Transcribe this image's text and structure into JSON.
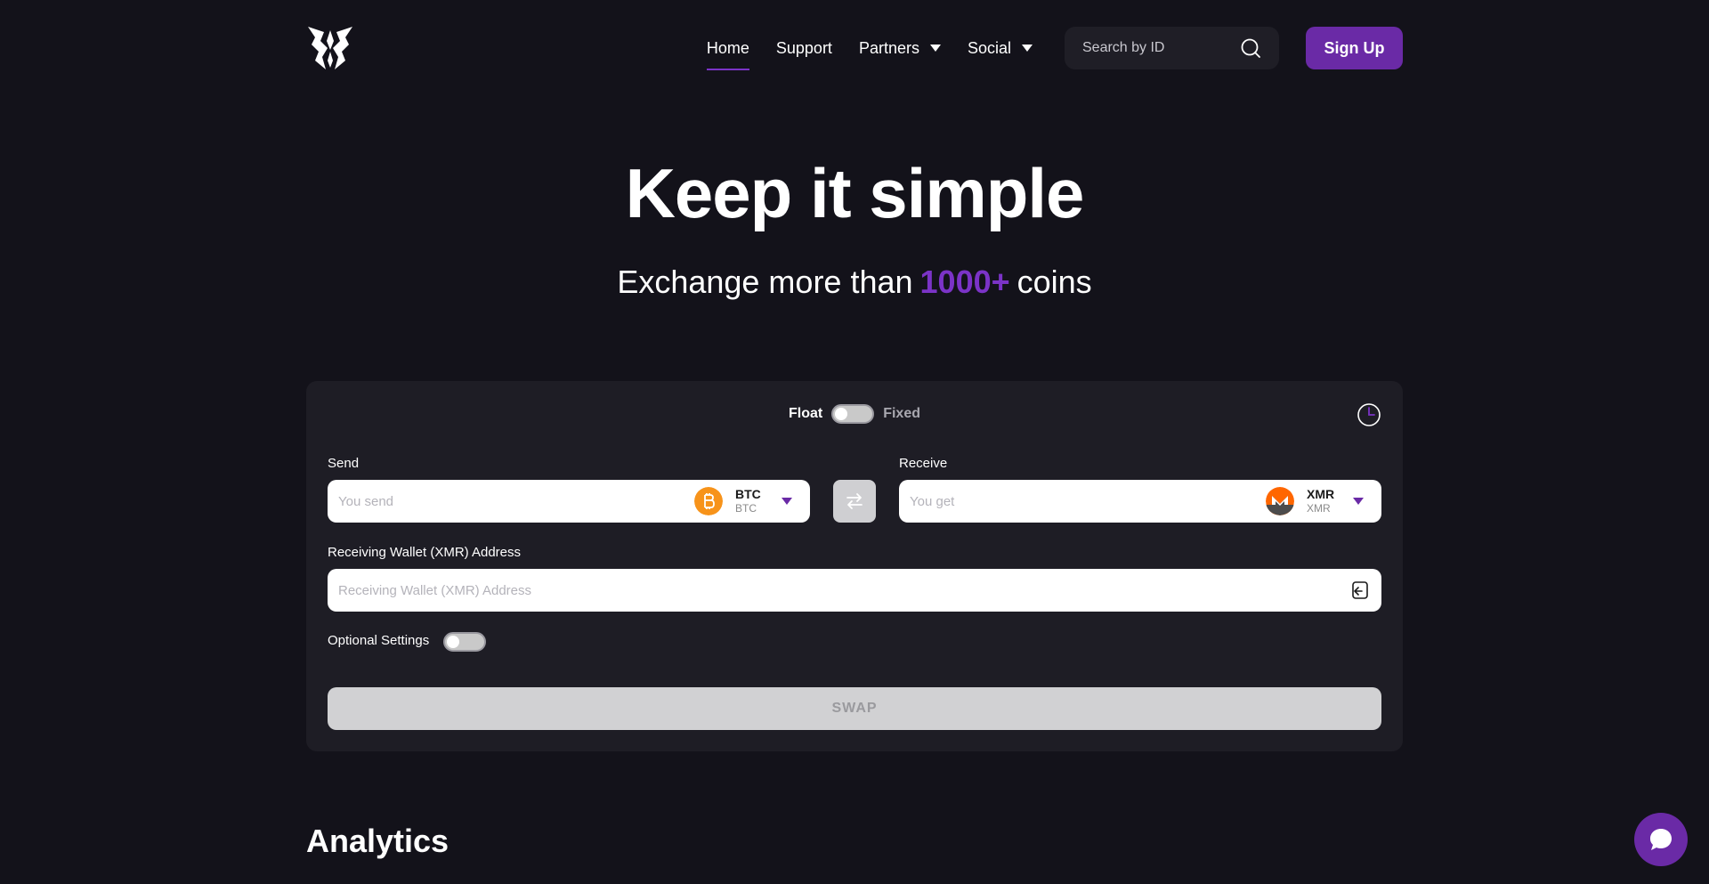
{
  "nav": {
    "items": [
      {
        "label": "Home",
        "active": true,
        "dropdown": false
      },
      {
        "label": "Support",
        "active": false,
        "dropdown": false
      },
      {
        "label": "Partners",
        "active": false,
        "dropdown": true
      },
      {
        "label": "Social",
        "active": false,
        "dropdown": true
      }
    ],
    "search_placeholder": "Search by ID",
    "signup_label": "Sign Up"
  },
  "hero": {
    "title": "Keep it simple",
    "subtitle_pre": "Exchange more than",
    "subtitle_accent": "1000+",
    "subtitle_post": "coins"
  },
  "exchange": {
    "mode_float": "Float",
    "mode_fixed": "Fixed",
    "send_label": "Send",
    "send_placeholder": "You send",
    "send_coin": {
      "ticker": "BTC",
      "network": "BTC",
      "icon": "bitcoin-icon",
      "color": "#f7931a"
    },
    "receive_label": "Receive",
    "receive_placeholder": "You get",
    "receive_coin": {
      "ticker": "XMR",
      "network": "XMR",
      "icon": "monero-icon",
      "color": "#ff6600"
    },
    "wallet_label": "Receiving Wallet (XMR) Address",
    "wallet_placeholder": "Receiving Wallet (XMR) Address",
    "optional_label": "Optional Settings",
    "swap_label": "SWAP"
  },
  "analytics_title": "Analytics",
  "colors": {
    "background": "#13121a",
    "card": "#1e1d25",
    "accent": "#7b33c7",
    "button": "#6a2aa6"
  }
}
